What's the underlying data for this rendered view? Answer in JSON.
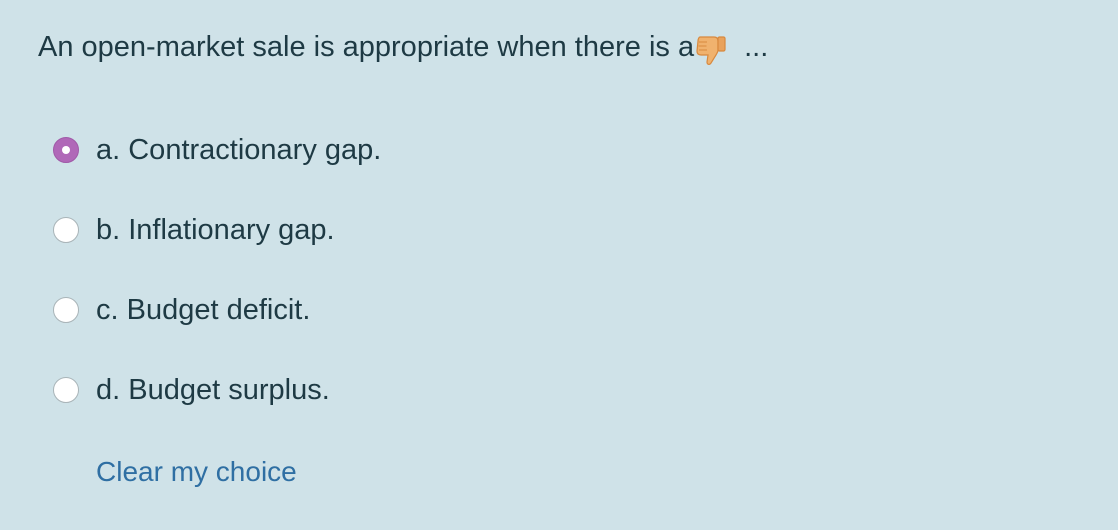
{
  "question": {
    "text": "An open-market sale is appropriate when there is a",
    "icon": "thumbs-down-icon",
    "trailing": "..."
  },
  "options": [
    {
      "label": "a. Contractionary gap.",
      "selected": true
    },
    {
      "label": "b. Inflationary gap.",
      "selected": false
    },
    {
      "label": "c. Budget deficit.",
      "selected": false
    },
    {
      "label": "d. Budget surplus.",
      "selected": false
    }
  ],
  "actions": {
    "clear_label": "Clear my choice"
  },
  "colors": {
    "background": "#cfe2e8",
    "text": "#1e3a44",
    "selected_radio": "#b068b8",
    "link": "#2f6fa3"
  }
}
